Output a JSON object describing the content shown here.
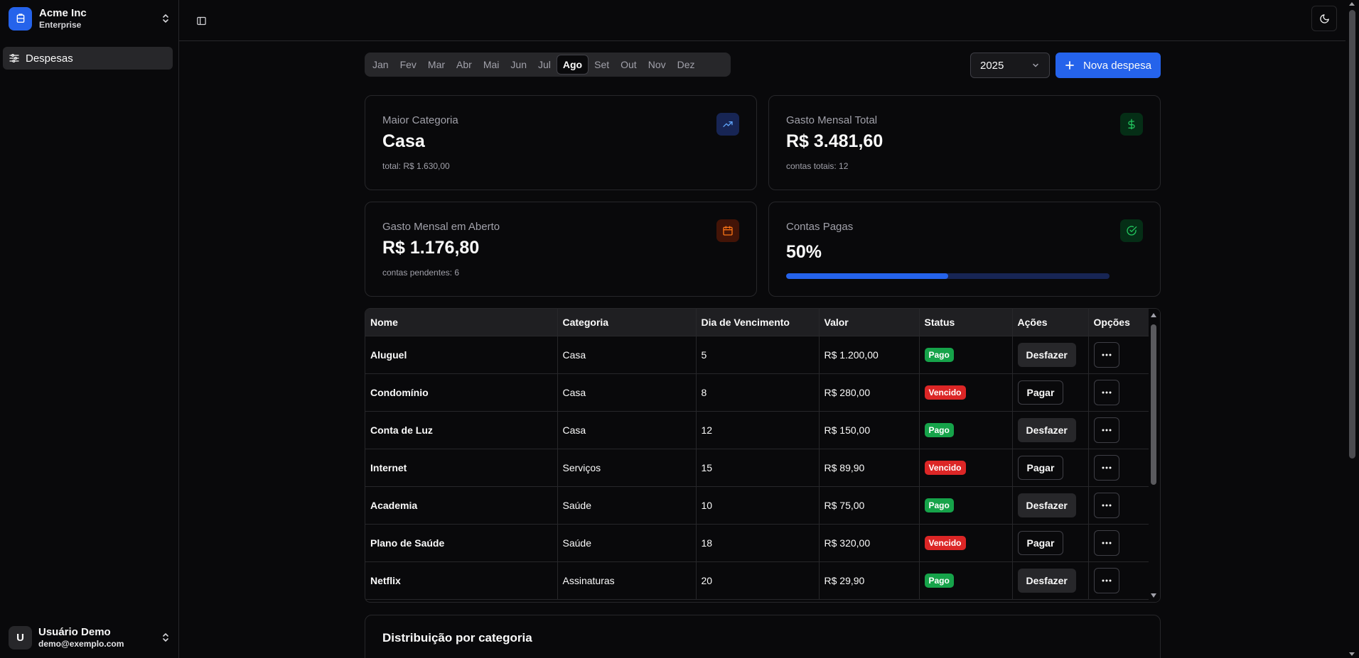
{
  "team": {
    "name": "Acme Inc",
    "plan": "Enterprise"
  },
  "nav": [
    {
      "label": "Despesas"
    }
  ],
  "user": {
    "initial": "U",
    "name": "Usuário Demo",
    "email": "demo@exemplo.com"
  },
  "months": [
    "Jan",
    "Fev",
    "Mar",
    "Abr",
    "Mai",
    "Jun",
    "Jul",
    "Ago",
    "Set",
    "Out",
    "Nov",
    "Dez"
  ],
  "active_month": "Ago",
  "year": "2025",
  "new_button": "Nova despesa",
  "cards": {
    "maior": {
      "label": "Maior Categoria",
      "value": "Casa",
      "sub": "total: R$ 1.630,00"
    },
    "total": {
      "label": "Gasto Mensal Total",
      "value": "R$ 3.481,60",
      "sub": "contas totais: 12"
    },
    "aberto": {
      "label": "Gasto Mensal em Aberto",
      "value": "R$ 1.176,80",
      "sub": "contas pendentes: 6"
    },
    "pagas": {
      "label": "Contas Pagas",
      "value": "50%",
      "progress": 0.5
    }
  },
  "colors": {
    "accent": "#2563eb",
    "pago": "#16a34a",
    "vencido": "#dc2626",
    "orange": "#f97316",
    "green": "#22c55e"
  },
  "table": {
    "headers": [
      "Nome",
      "Categoria",
      "Dia de Vencimento",
      "Valor",
      "Status",
      "Ações",
      "Opções"
    ],
    "rows": [
      {
        "nome": "Aluguel",
        "categoria": "Casa",
        "dia": "5",
        "valor": "R$ 1.200,00",
        "status": "Pago",
        "acao": "Desfazer"
      },
      {
        "nome": "Condomínio",
        "categoria": "Casa",
        "dia": "8",
        "valor": "R$ 280,00",
        "status": "Vencido",
        "acao": "Pagar"
      },
      {
        "nome": "Conta de Luz",
        "categoria": "Casa",
        "dia": "12",
        "valor": "R$ 150,00",
        "status": "Pago",
        "acao": "Desfazer"
      },
      {
        "nome": "Internet",
        "categoria": "Serviços",
        "dia": "15",
        "valor": "R$ 89,90",
        "status": "Vencido",
        "acao": "Pagar"
      },
      {
        "nome": "Academia",
        "categoria": "Saúde",
        "dia": "10",
        "valor": "R$ 75,00",
        "status": "Pago",
        "acao": "Desfazer"
      },
      {
        "nome": "Plano de Saúde",
        "categoria": "Saúde",
        "dia": "18",
        "valor": "R$ 320,00",
        "status": "Vencido",
        "acao": "Pagar"
      },
      {
        "nome": "Netflix",
        "categoria": "Assinaturas",
        "dia": "20",
        "valor": "R$ 29,90",
        "status": "Pago",
        "acao": "Desfazer"
      }
    ]
  },
  "distribution": {
    "title": "Distribuição por categoria"
  },
  "icons": [
    "chevrons-up-down-icon",
    "sidebar-toggle-icon",
    "moon-icon",
    "trending-up-icon",
    "dollar-icon",
    "calendar-icon",
    "check-circle-icon",
    "plus-icon",
    "ellipsis-icon",
    "chevron-down-icon",
    "layers-icon",
    "sliders-icon"
  ]
}
